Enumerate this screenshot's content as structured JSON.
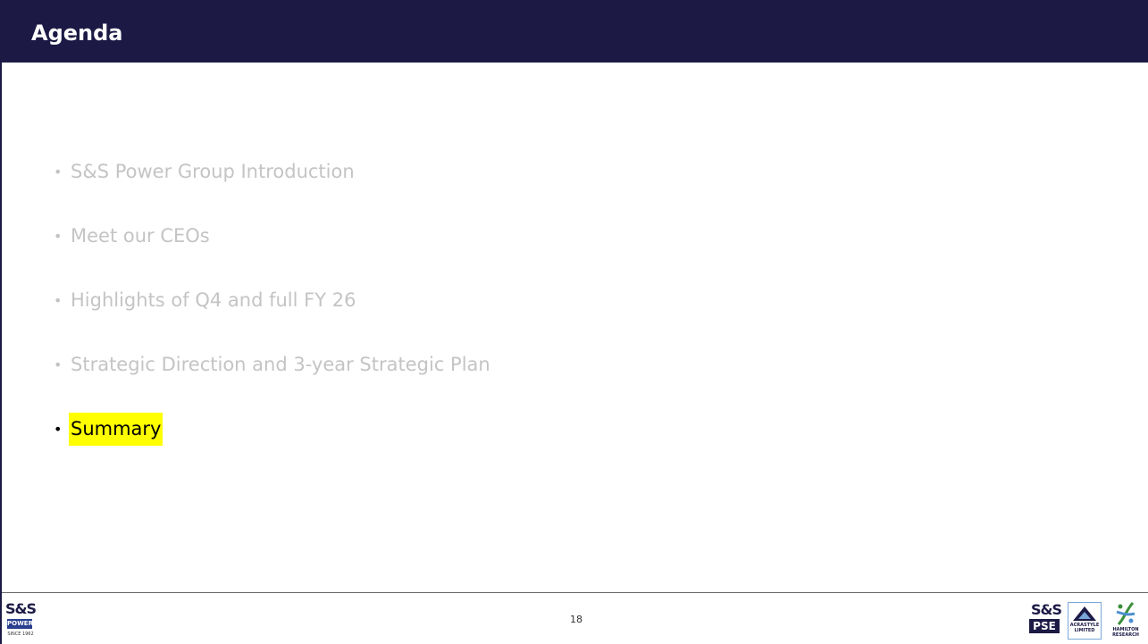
{
  "slide": {
    "title": "Agenda",
    "page_number": "18"
  },
  "agenda": {
    "items": [
      {
        "label": "S&S Power Group Introduction",
        "active": false
      },
      {
        "label": "Meet our CEOs",
        "active": false
      },
      {
        "label": "Highlights of Q4 and full FY 26",
        "active": false
      },
      {
        "label": "Strategic Direction and 3-year Strategic Plan",
        "active": false
      },
      {
        "label": "Summary",
        "active": true
      }
    ],
    "bullet": "•"
  },
  "logos": {
    "sas_power": {
      "top": "S&S",
      "bottom": "POWER",
      "since": "SINCE 1962"
    },
    "sas_pse": {
      "top": "S&S",
      "bottom": "PSE"
    },
    "acrastyle": {
      "text": "ACRASTYLE LIMITED"
    },
    "hamilton": {
      "text": "HAMILTON RESEARCH"
    }
  },
  "colors": {
    "title_bar": "#1c1a45",
    "inactive_text": "#c4c4c4",
    "highlight": "#ffff00"
  }
}
